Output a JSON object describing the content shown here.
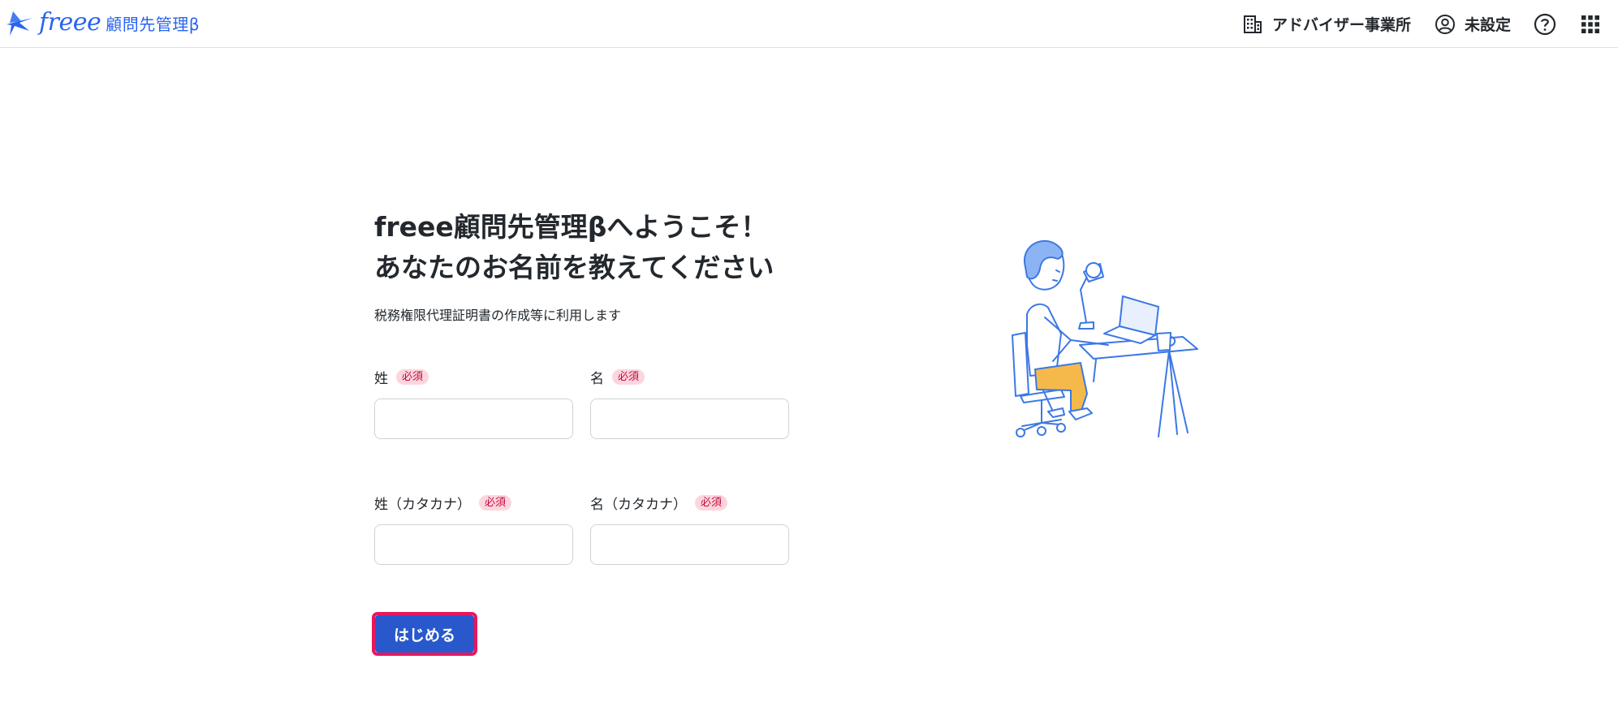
{
  "header": {
    "brand_wordmark": "freee",
    "brand_product": "顧問先管理β",
    "office_label": "アドバイザー事業所",
    "user_label": "未設定",
    "icons": {
      "brand": "freee-bird-logo-icon",
      "office": "building-icon",
      "user": "user-circle-icon",
      "help": "help-circle-icon",
      "apps": "app-grid-icon"
    }
  },
  "form": {
    "title_line1": "freee顧問先管理βへようこそ！",
    "title_line2": "あなたのお名前を教えてください",
    "subtitle": "税務権限代理証明書の作成等に利用します",
    "required_label": "必須",
    "fields": {
      "last_name": {
        "label": "姓",
        "value": "",
        "placeholder": ""
      },
      "first_name": {
        "label": "名",
        "value": "",
        "placeholder": ""
      },
      "last_name_kana": {
        "label": "姓（カタカナ）",
        "value": "",
        "placeholder": ""
      },
      "first_name_kana": {
        "label": "名（カタカナ）",
        "value": "",
        "placeholder": ""
      }
    },
    "submit_label": "はじめる"
  },
  "colors": {
    "brand_blue": "#2864f0",
    "primary_button": "#2858cc",
    "required_badge_bg": "#fbd6de",
    "required_badge_text": "#c30c3d",
    "highlight_outline": "#e8175d",
    "illustration_blue": "#3c78e6",
    "illustration_yellow": "#f5b94b"
  },
  "illustration": {
    "icon": "person-working-at-laptop-illustration"
  }
}
